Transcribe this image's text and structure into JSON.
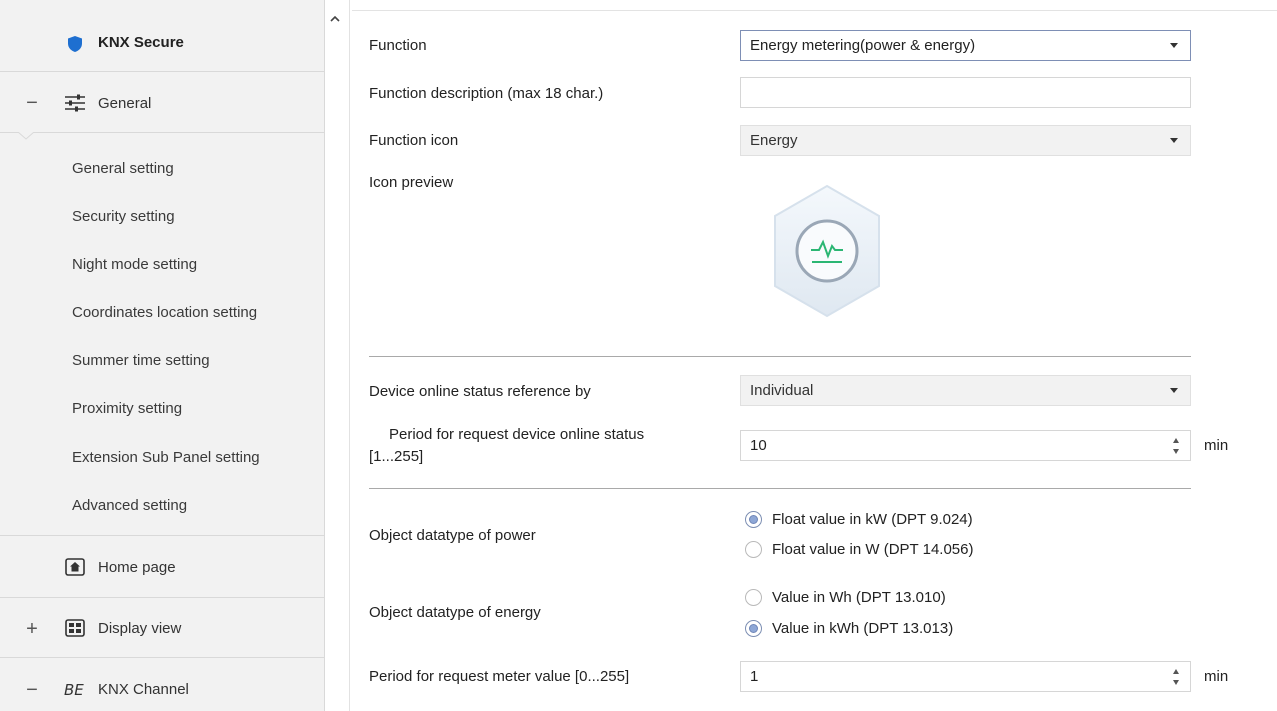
{
  "sidebar": {
    "top_item": {
      "label": "KNX Secure",
      "icon": "shield-icon"
    },
    "general": {
      "sign": "−",
      "label": "General",
      "icon": "sliders-icon"
    },
    "sub_items": [
      "General setting",
      "Security setting",
      "Night mode setting",
      "Coordinates location setting",
      "Summer time setting",
      "Proximity setting",
      "Extension Sub Panel setting",
      "Advanced setting"
    ],
    "home_page": {
      "label": "Home page",
      "icon": "home-icon"
    },
    "display_view": {
      "sign": "+",
      "label": "Display view",
      "icon": "display-grid-icon"
    },
    "knx_channel": {
      "sign": "−",
      "label": "KNX Channel",
      "icon": "channel-icon"
    }
  },
  "form": {
    "function": {
      "label": "Function",
      "value": "Energy metering(power & energy)"
    },
    "description": {
      "label": "Function description (max 18 char.)",
      "value": ""
    },
    "icon": {
      "label": "Function icon",
      "value": "Energy"
    },
    "preview": {
      "label": "Icon preview",
      "icon": "energy-pulse-icon"
    },
    "online_ref": {
      "label": "Device online status reference by",
      "value": "Individual"
    },
    "period_online": {
      "label_line1": "Period for request device online status",
      "label_line2": "[1...255]",
      "value": "10",
      "unit": "min"
    },
    "power_type": {
      "label": "Object datatype of power",
      "options": [
        "Float value in kW (DPT 9.024)",
        "Float value in W (DPT 14.056)"
      ],
      "selected": 0
    },
    "energy_type": {
      "label": "Object datatype of energy",
      "options": [
        "Value in Wh (DPT 13.010)",
        "Value in kWh (DPT 13.013)"
      ],
      "selected": 1
    },
    "period_meter": {
      "label": "Period for request meter value [0...255]",
      "value": "1",
      "unit": "min"
    }
  },
  "colors": {
    "accent": "#8ea7d6",
    "shield": "#1e6fd0",
    "energy": "#2bb673"
  }
}
